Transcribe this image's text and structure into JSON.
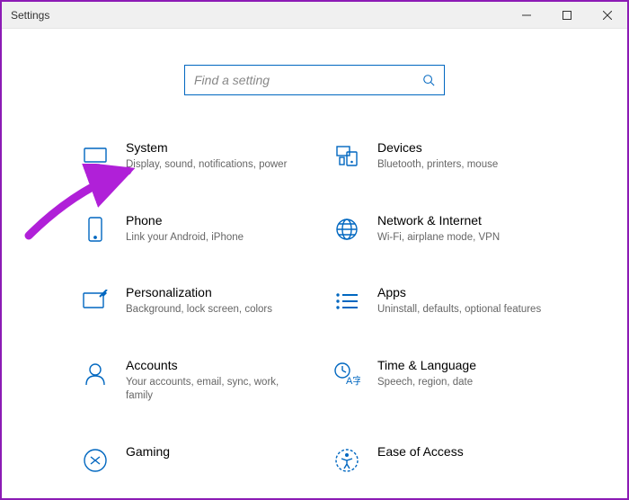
{
  "window": {
    "title": "Settings"
  },
  "search": {
    "placeholder": "Find a setting"
  },
  "tiles": [
    {
      "title": "System",
      "desc": "Display, sound, notifications, power"
    },
    {
      "title": "Devices",
      "desc": "Bluetooth, printers, mouse"
    },
    {
      "title": "Phone",
      "desc": "Link your Android, iPhone"
    },
    {
      "title": "Network & Internet",
      "desc": "Wi-Fi, airplane mode, VPN"
    },
    {
      "title": "Personalization",
      "desc": "Background, lock screen, colors"
    },
    {
      "title": "Apps",
      "desc": "Uninstall, defaults, optional features"
    },
    {
      "title": "Accounts",
      "desc": "Your accounts, email, sync, work, family"
    },
    {
      "title": "Time & Language",
      "desc": "Speech, region, date"
    },
    {
      "title": "Gaming",
      "desc": ""
    },
    {
      "title": "Ease of Access",
      "desc": ""
    }
  ]
}
